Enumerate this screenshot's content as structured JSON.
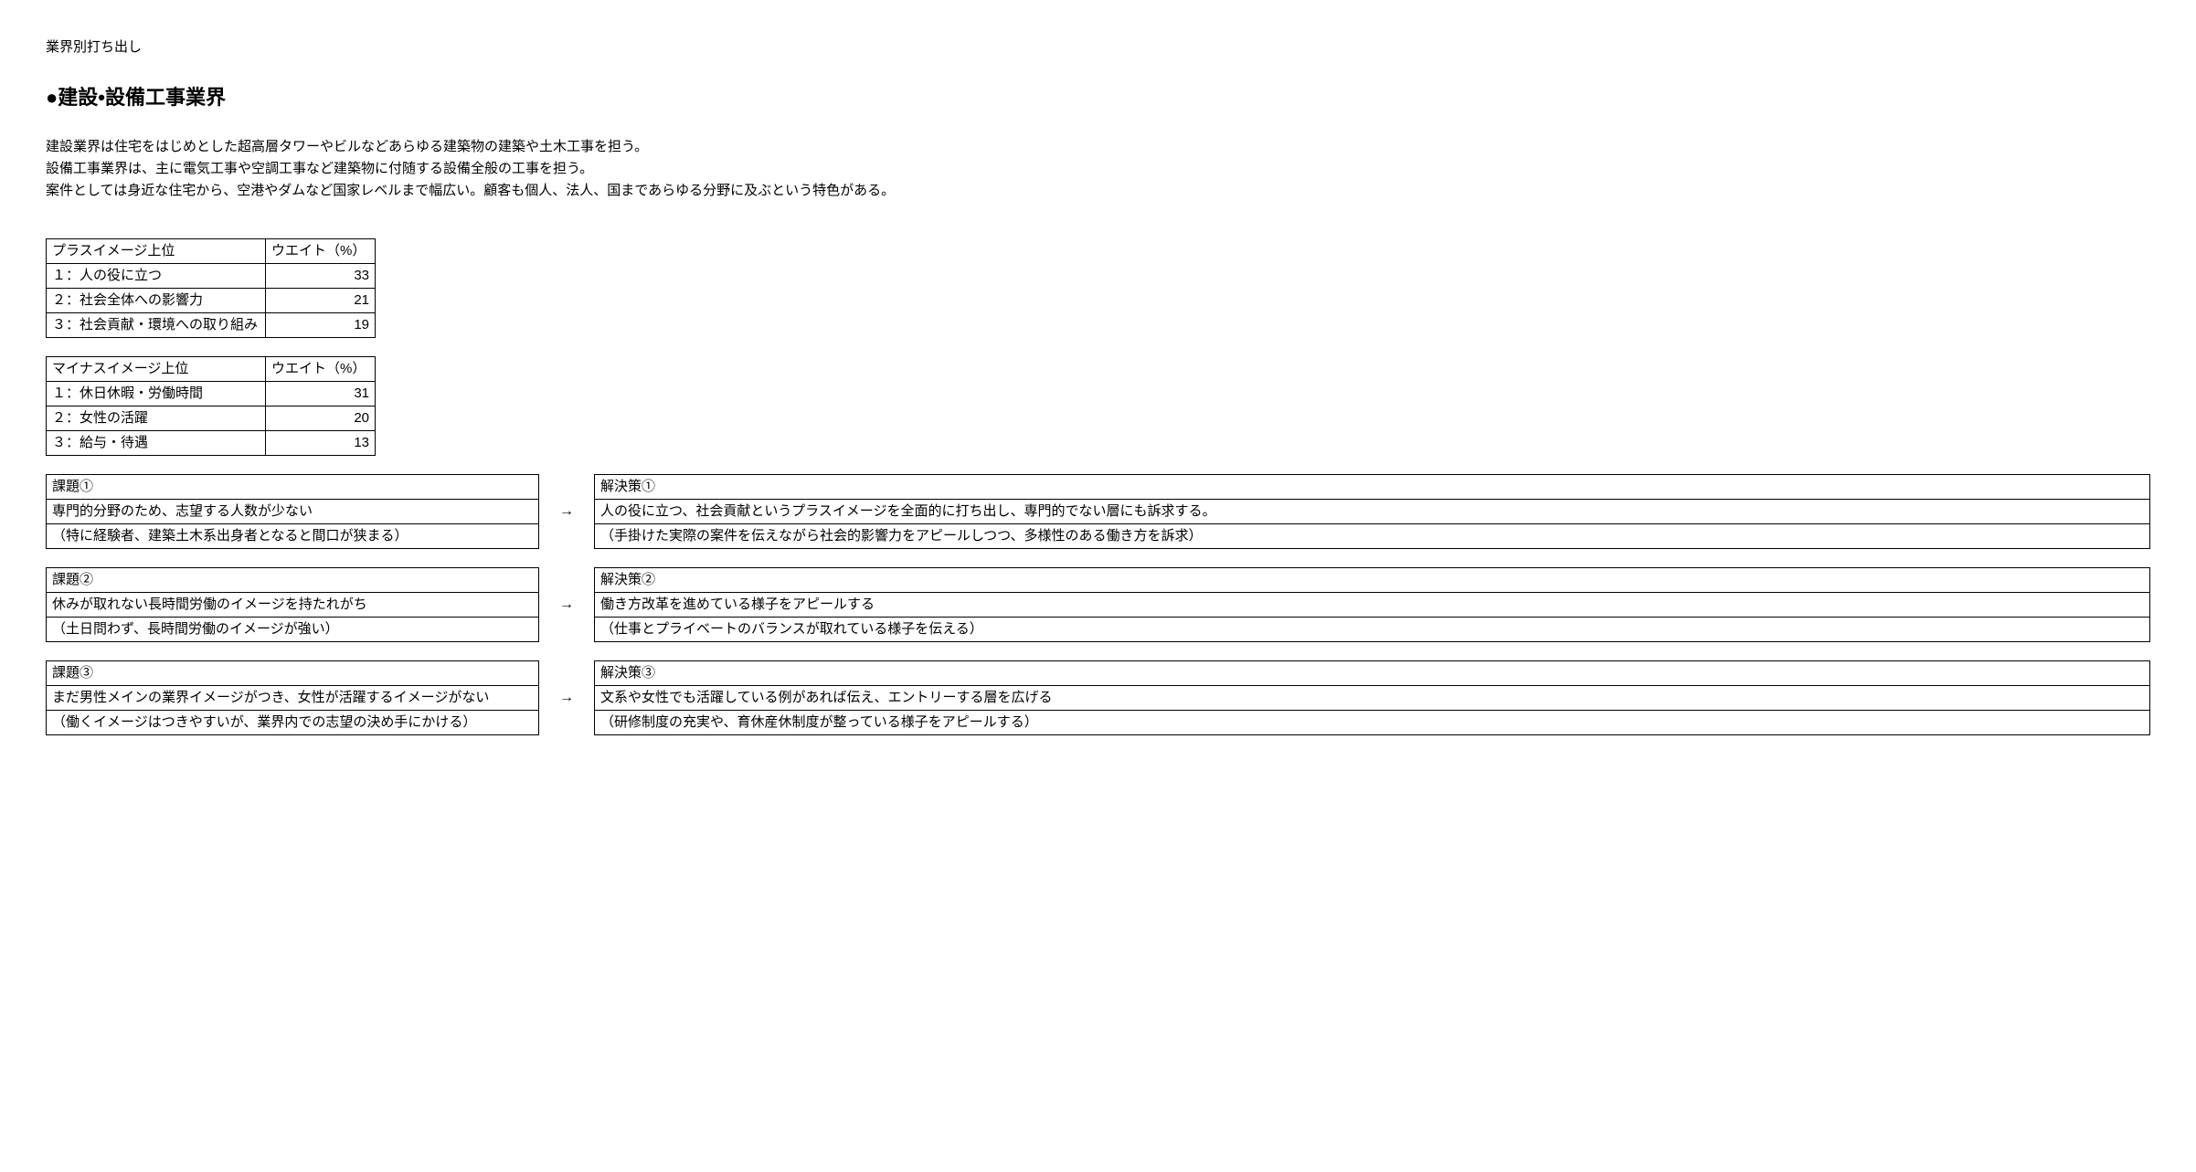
{
  "page_label": "業界別打ち出し",
  "heading": "●建設•設備工事業界",
  "intro": [
    "建設業界は住宅をはじめとした超高層タワーやビルなどあらゆる建築物の建築や土木工事を担う。",
    "設備工事業界は、主に電気工事や空調工事など建築物に付随する設備全般の工事を担う。",
    "案件としては身近な住宅から、空港やダムなど国家レベルまで幅広い。顧客も個人、法人、国まであらゆる分野に及ぶという特色がある。"
  ],
  "positive_table": {
    "header_label": "プラスイメージ上位",
    "header_weight": "ウエイト（%）",
    "rows": [
      {
        "label": "１：人の役に立つ",
        "weight": "33"
      },
      {
        "label": "２：社会全体への影響力",
        "weight": "21"
      },
      {
        "label": "３：社会貢献・環境への取り組み",
        "weight": "19"
      }
    ]
  },
  "negative_table": {
    "header_label": "マイナスイメージ上位",
    "header_weight": "ウエイト（%）",
    "rows": [
      {
        "label": "１：休日休暇・労働時間",
        "weight": "31"
      },
      {
        "label": "２：女性の活躍",
        "weight": "20"
      },
      {
        "label": "３：給与・待遇",
        "weight": "13"
      }
    ]
  },
  "arrow": "→",
  "issues": [
    {
      "issue_title": "課題①",
      "issue_line1": "専門的分野のため、志望する人数が少ない",
      "issue_line2": "（特に経験者、建築土木系出身者となると間口が狭まる）",
      "solution_title": "解決策①",
      "solution_line1": "人の役に立つ、社会貢献というプラスイメージを全面的に打ち出し、専門的でない層にも訴求する。",
      "solution_line2": "（手掛けた実際の案件を伝えながら社会的影響力をアピールしつつ、多様性のある働き方を訴求）"
    },
    {
      "issue_title": "課題②",
      "issue_line1": "休みが取れない長時間労働のイメージを持たれがち",
      "issue_line2": "（土日問わず、長時間労働のイメージが強い）",
      "solution_title": "解決策②",
      "solution_line1": "働き方改革を進めている様子をアピールする",
      "solution_line2": "（仕事とプライベートのバランスが取れている様子を伝える）"
    },
    {
      "issue_title": "課題③",
      "issue_line1": "まだ男性メインの業界イメージがつき、女性が活躍するイメージがない",
      "issue_line2": "（働くイメージはつきやすいが、業界内での志望の決め手にかける）",
      "solution_title": "解決策③",
      "solution_line1": "文系や女性でも活躍している例があれば伝え、エントリーする層を広げる",
      "solution_line2": "（研修制度の充実や、育休産休制度が整っている様子をアピールする）"
    }
  ]
}
